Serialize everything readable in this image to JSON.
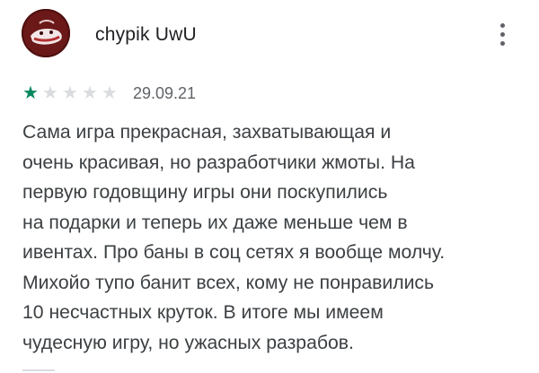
{
  "review": {
    "author": "chypik UwU",
    "rating": {
      "value": 1,
      "max": 5
    },
    "date": "29.09.21",
    "text_lines": [
      "Сама игра прекрасная, захватывающая и",
      "очень красивая, но разработчики жмоты. На",
      "первую годовщину игры они поскупились",
      "на подарки и теперь их даже меньше чем в",
      "ивентах. Про баны в соц сетях я вообще молчу.",
      "Михойо тупо банит всех, кому не понравились",
      "10 несчастных круток. В итоге мы имеем",
      "чудесную игру, но ужасных разрабов."
    ]
  },
  "icons": {
    "more": "more-vert-icon",
    "star": "star-icon"
  },
  "colors": {
    "star_filled": "#01875f",
    "star_empty": "#dadce0",
    "text": "#3c4043",
    "secondary": "#5f6368"
  }
}
